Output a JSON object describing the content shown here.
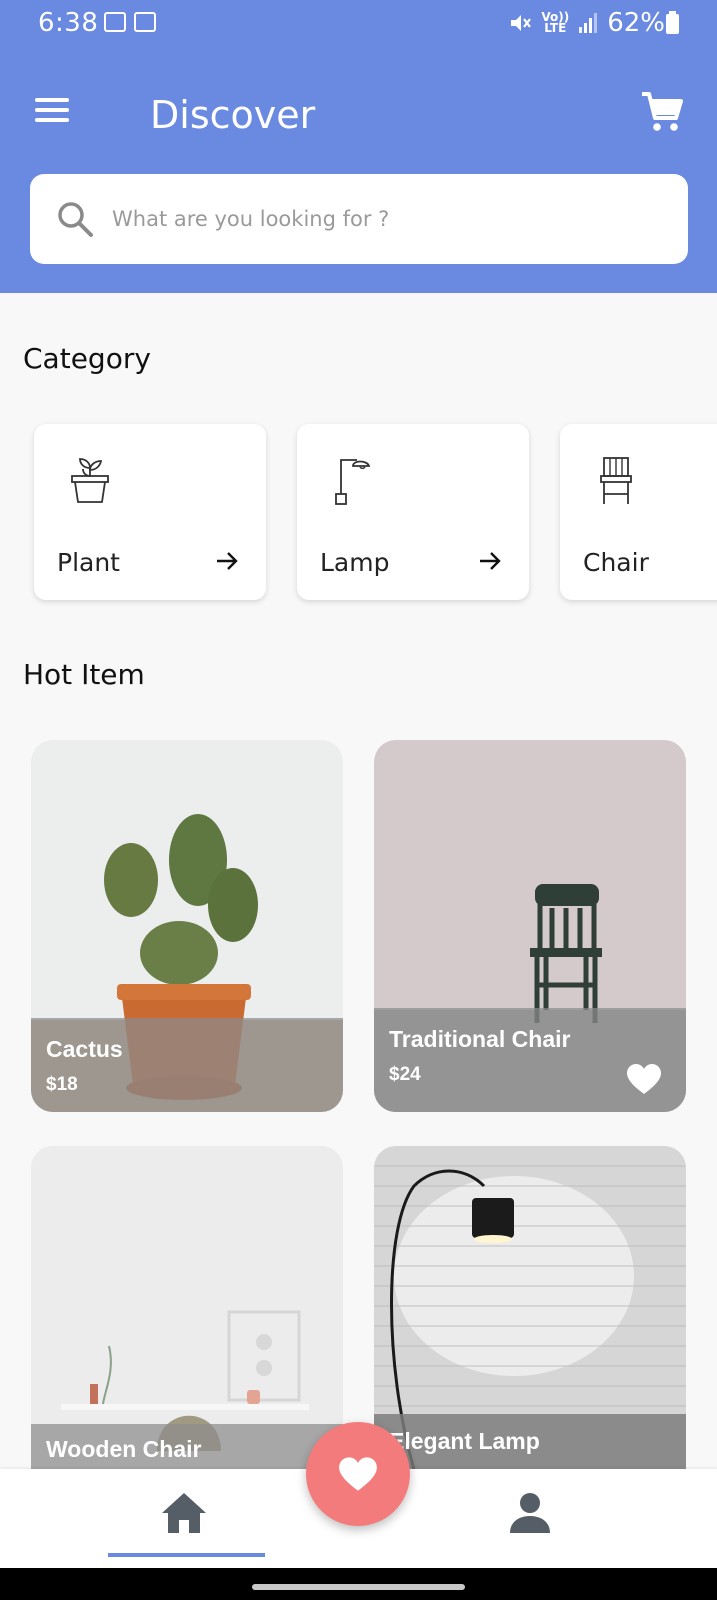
{
  "status_bar": {
    "time": "6:38",
    "net_top": "Vo))",
    "net_bottom": "LTE",
    "battery": "62%"
  },
  "header": {
    "title": "Discover",
    "menu_icon": "hamburger-menu-icon",
    "cart_icon": "shopping-cart-icon",
    "color": "#6a89e0"
  },
  "search": {
    "placeholder": "What are you looking for ?",
    "value": ""
  },
  "category": {
    "title": "Category",
    "items": [
      {
        "label": "Plant",
        "icon": "plant-pot-icon"
      },
      {
        "label": "Lamp",
        "icon": "floor-lamp-icon"
      },
      {
        "label": "Chair",
        "icon": "chair-icon"
      }
    ]
  },
  "hot_items": {
    "title": "Hot Item",
    "items": [
      {
        "name": "Cactus",
        "price": "$18",
        "favorited": false
      },
      {
        "name": "Traditional Chair",
        "price": "$24",
        "favorited": true
      },
      {
        "name": "Wooden Chair",
        "price": "",
        "favorited": false
      },
      {
        "name": "Elegant Lamp",
        "price": "",
        "favorited": false
      }
    ]
  },
  "bottom_nav": {
    "items": [
      "home",
      "favorites",
      "profile"
    ],
    "active": "home",
    "fab_color": "#f47b7b"
  }
}
